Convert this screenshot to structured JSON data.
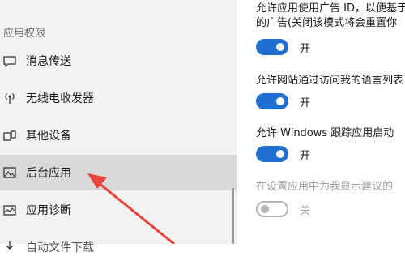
{
  "sidebar": {
    "section_header": "应用权限",
    "items": [
      {
        "label": "消息传送",
        "icon": "message-icon"
      },
      {
        "label": "无线电收发器",
        "icon": "antenna-icon"
      },
      {
        "label": "其他设备",
        "icon": "devices-icon"
      },
      {
        "label": "后台应用",
        "icon": "background-apps-icon",
        "selected": true
      },
      {
        "label": "应用诊断",
        "icon": "diagnostics-icon"
      },
      {
        "label": "自动文件下载",
        "icon": "download-icon"
      }
    ]
  },
  "settings": [
    {
      "text_line1": "允许应用使用广告 ID，以便基于",
      "text_line2": "的广告(关闭该模式将会重置你",
      "state": "开",
      "on": true,
      "disabled": false
    },
    {
      "text_line1": "允许网站通过访问我的语言列表",
      "state": "开",
      "on": true,
      "disabled": false
    },
    {
      "text_line1": "允许 Windows 跟踪应用启动",
      "state": "开",
      "on": true,
      "disabled": false
    },
    {
      "text_line1": "在设置应用中为我显示建议的",
      "state": "关",
      "on": false,
      "disabled": true
    }
  ],
  "colors": {
    "accent": "#1f6fd0",
    "arrow": "#e8433a",
    "selected_bg": "#d9d9d9"
  }
}
